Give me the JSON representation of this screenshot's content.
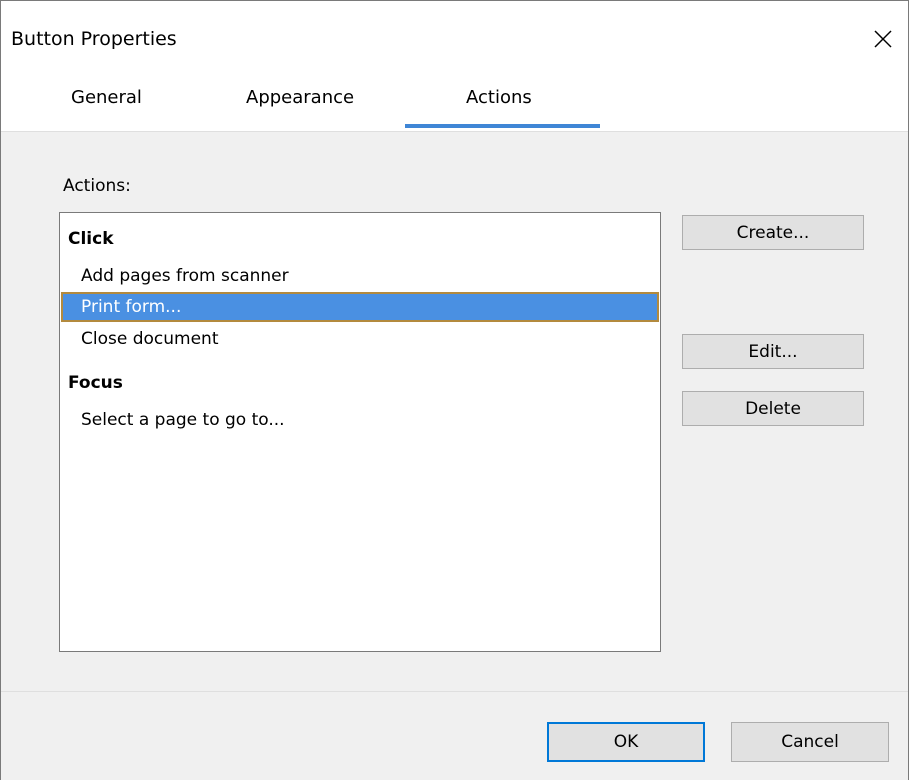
{
  "window": {
    "title": "Button Properties",
    "close_icon": "close-icon"
  },
  "tabs": [
    {
      "label": "General",
      "selected": false
    },
    {
      "label": "Appearance",
      "selected": false
    },
    {
      "label": "Actions",
      "selected": true
    }
  ],
  "colors": {
    "tab_indicator": "#3f86d6",
    "selection_fill": "#4a90e2",
    "selection_border": "#b38a3e",
    "default_button_border": "#0078d7",
    "panel_background": "#f0f0f0"
  },
  "actions_panel": {
    "label": "Actions:",
    "groups": [
      {
        "header": "Click",
        "items": [
          {
            "label": "Add pages from scanner",
            "selected": false
          },
          {
            "label": "Print form...",
            "selected": true
          },
          {
            "label": "Close document",
            "selected": false
          }
        ]
      },
      {
        "header": "Focus",
        "items": [
          {
            "label": "Select a page to go to...",
            "selected": false
          }
        ]
      }
    ]
  },
  "side_buttons": {
    "create": "Create...",
    "edit": "Edit...",
    "delete": "Delete"
  },
  "footer": {
    "ok": "OK",
    "cancel": "Cancel"
  }
}
